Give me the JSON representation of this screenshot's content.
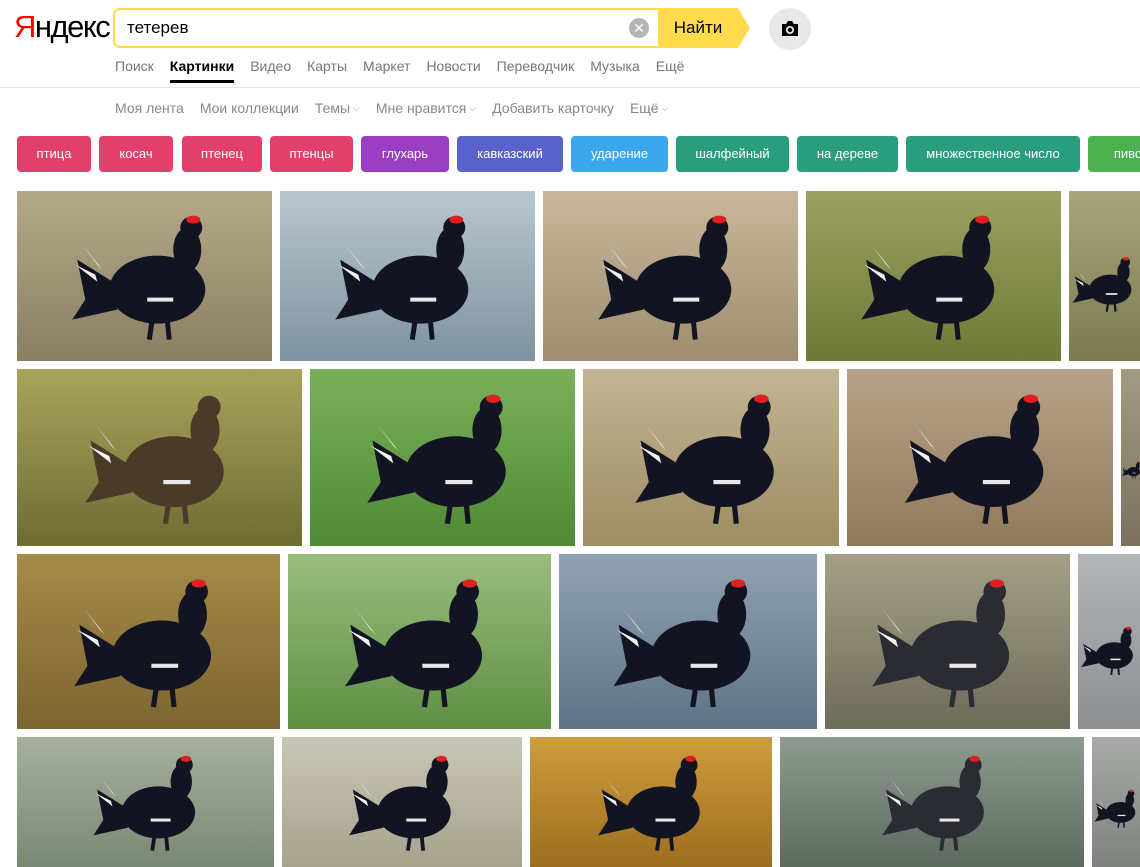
{
  "logo": {
    "first_letter": "Я",
    "rest": "ндекс"
  },
  "search": {
    "query": "тетерев",
    "clear_label": "✕",
    "button_label": "Найти"
  },
  "services": [
    {
      "label": "Поиск",
      "active": false
    },
    {
      "label": "Картинки",
      "active": true
    },
    {
      "label": "Видео",
      "active": false
    },
    {
      "label": "Карты",
      "active": false
    },
    {
      "label": "Маркет",
      "active": false
    },
    {
      "label": "Новости",
      "active": false
    },
    {
      "label": "Переводчик",
      "active": false
    },
    {
      "label": "Музыка",
      "active": false
    },
    {
      "label": "Ещё",
      "active": false
    }
  ],
  "subnav": [
    {
      "label": "Моя лента",
      "caret": false
    },
    {
      "label": "Мои коллекции",
      "caret": false
    },
    {
      "label": "Темы",
      "caret": true
    },
    {
      "label": "Мне нравится",
      "caret": true
    },
    {
      "label": "Добавить карточку",
      "caret": false
    },
    {
      "label": "Ещё",
      "caret": true
    }
  ],
  "chips": [
    {
      "label": "птица",
      "color": "#e0406b"
    },
    {
      "label": "косач",
      "color": "#e0406b"
    },
    {
      "label": "птенец",
      "color": "#e0406b"
    },
    {
      "label": "птенцы",
      "color": "#e0406b"
    },
    {
      "label": "глухарь",
      "color": "#9b3fc2"
    },
    {
      "label": "кавказский",
      "color": "#5862c8"
    },
    {
      "label": "ударение",
      "color": "#3ba6ec"
    },
    {
      "label": "шалфейный",
      "color": "#2a9d7f"
    },
    {
      "label": "на дереве",
      "color": "#2a9d7f"
    },
    {
      "label": "множественное число",
      "color": "#2a9d7f"
    },
    {
      "label": "пиво",
      "color": "#4caf50"
    }
  ],
  "colors": {
    "accent": "#ffdb4d",
    "logo_red": "#ff0000"
  }
}
